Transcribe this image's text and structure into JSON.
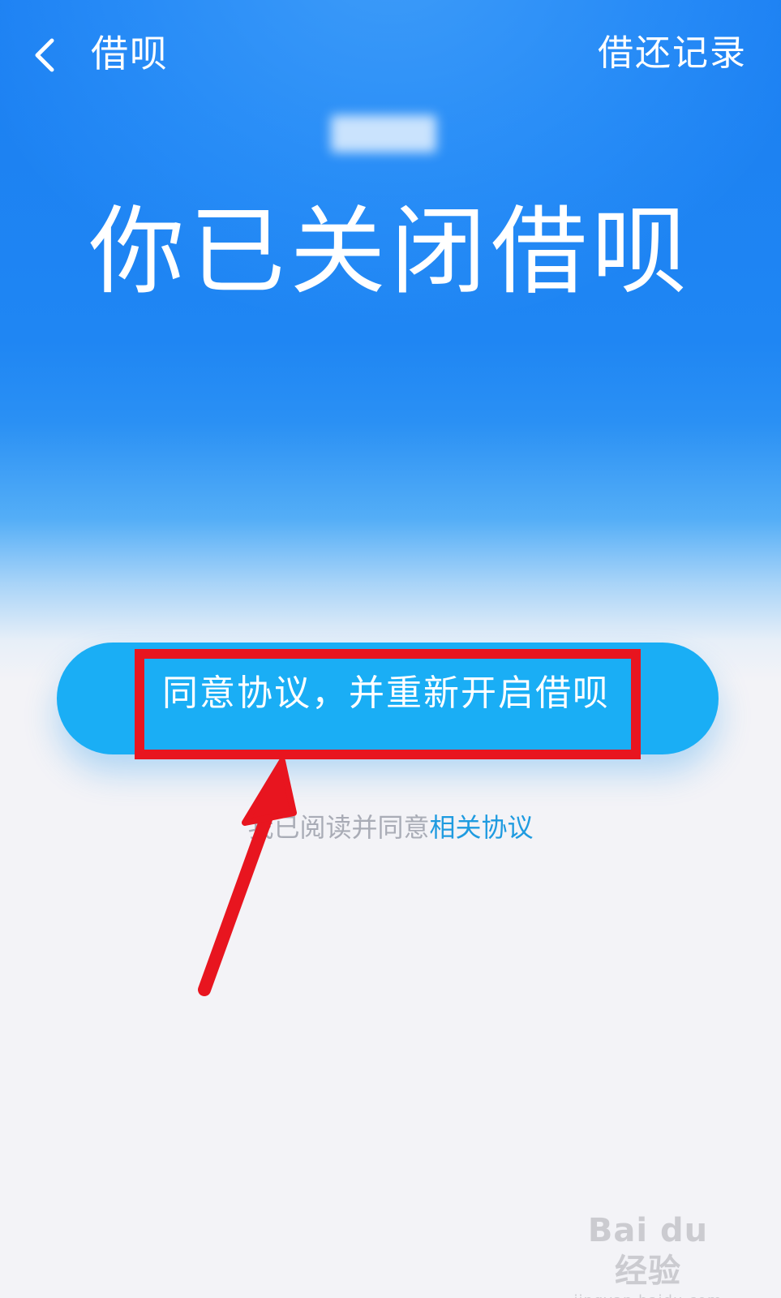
{
  "navbar": {
    "back_icon": "chevron-left-icon",
    "title": "借呗",
    "records_link": "借还记录"
  },
  "status": {
    "headline": "你已关闭借呗"
  },
  "actions": {
    "reopen_button_label": "同意协议，并重新开启借呗"
  },
  "agreement": {
    "prefix": "我已阅读并同意",
    "link_label": "相关协议"
  },
  "annotation": {
    "highlight_color": "#e8151f",
    "arrow_color": "#e8151f"
  },
  "watermark": {
    "logo_text": "Bai du 经验",
    "url_text": "jingyan.baidu.com"
  },
  "colors": {
    "primary_blue": "#1b7ff2",
    "button_blue": "#1aaef5",
    "link_blue": "#1f9be0",
    "background": "#f3f3f7"
  }
}
